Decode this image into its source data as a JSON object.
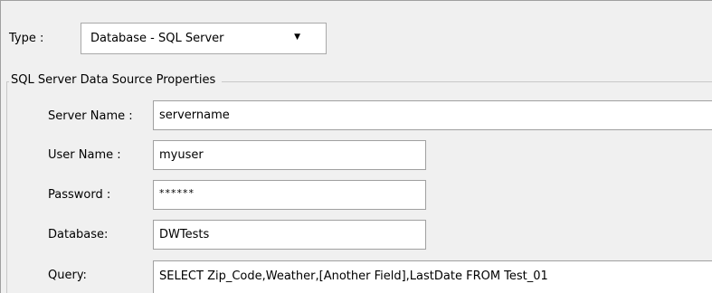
{
  "type": {
    "label": "Type :",
    "selected": "Database - SQL Server",
    "arrow_icon": "chevron-down-icon"
  },
  "group": {
    "title": "SQL Server Data Source Properties"
  },
  "fields": {
    "server_name": {
      "label": "Server Name :",
      "value": "servername"
    },
    "user_name": {
      "label": "User Name :",
      "value": "myuser"
    },
    "password": {
      "label": "Password :",
      "value": "******"
    },
    "database": {
      "label": "Database:",
      "value": "DWTests"
    },
    "query": {
      "label": "Query:",
      "value": "SELECT Zip_Code,Weather,[Another Field],LastDate FROM Test_01"
    }
  }
}
